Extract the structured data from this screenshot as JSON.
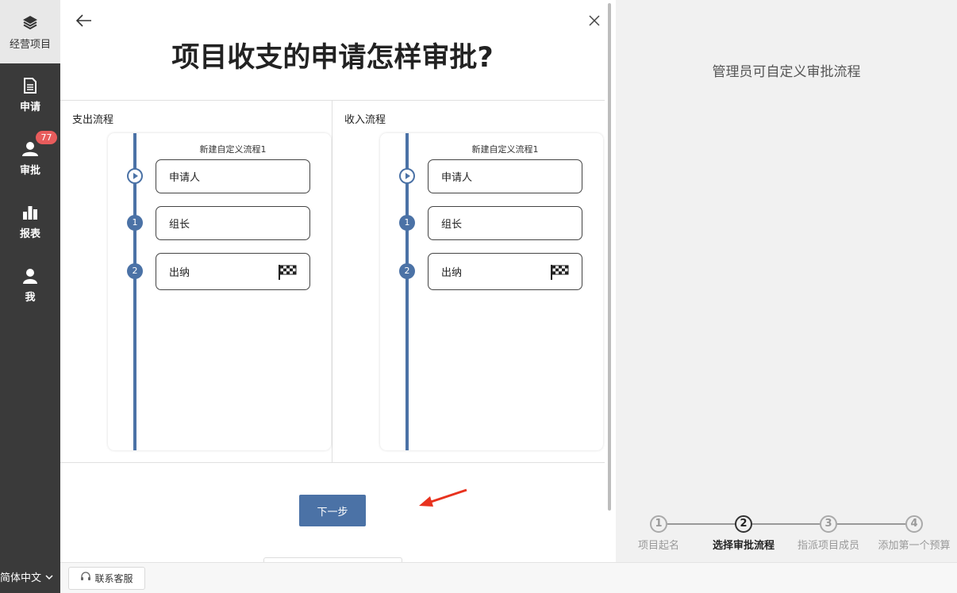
{
  "sidebar": {
    "items": [
      {
        "label": "经营项目",
        "icon": "layers-icon"
      },
      {
        "label": "申请",
        "icon": "document-icon"
      },
      {
        "label": "审批",
        "icon": "user-icon"
      },
      {
        "label": "报表",
        "icon": "bar-chart-icon"
      },
      {
        "label": "我",
        "icon": "person-icon"
      }
    ],
    "approval_badge": "77",
    "language": "简体中文"
  },
  "modal": {
    "title": "项目收支的申请怎样审批?",
    "expense": {
      "section_title": "支出流程",
      "flow_name": "新建自定义流程1",
      "steps": [
        {
          "marker": "",
          "label": "申请人"
        },
        {
          "marker": "1",
          "label": "组长"
        },
        {
          "marker": "2",
          "label": "出纳"
        }
      ]
    },
    "income": {
      "section_title": "收入流程",
      "flow_name": "新建自定义流程1",
      "steps": [
        {
          "marker": "",
          "label": "申请人"
        },
        {
          "marker": "1",
          "label": "组长"
        },
        {
          "marker": "2",
          "label": "出纳"
        }
      ]
    },
    "next_label": "下一步"
  },
  "right_panel": {
    "title": "管理员可自定义审批流程",
    "progress": [
      {
        "num": "1",
        "label": "项目起名"
      },
      {
        "num": "2",
        "label": "选择审批流程"
      },
      {
        "num": "3",
        "label": "指派项目成员"
      },
      {
        "num": "4",
        "label": "添加第一个预算"
      }
    ],
    "current_step": 2
  },
  "footer": {
    "support_label": "联系客服"
  },
  "colors": {
    "accent": "#4b72a6",
    "sidebar_bg": "#3a3a3a",
    "badge": "#e85c5c",
    "arrow": "#e8321e"
  }
}
